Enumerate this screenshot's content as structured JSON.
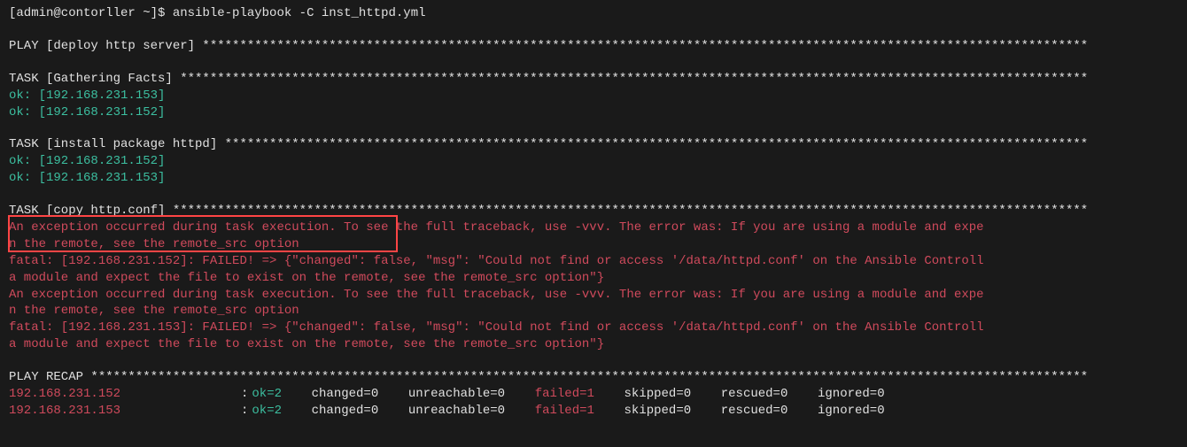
{
  "prompt": "[admin@contorller ~]$ ",
  "command": "ansible-playbook -C inst_httpd.yml",
  "play_header": "PLAY [deploy http server] ***********************************************************************************************************************",
  "task_gathering": "TASK [Gathering Facts] **************************************************************************************************************************",
  "ok_153": "ok: [192.168.231.153]",
  "ok_152": "ok: [192.168.231.152]",
  "task_install": "TASK [install package httpd] ********************************************************************************************************************",
  "task_copy": "TASK [copy http.conf] ***************************************************************************************************************************",
  "exception_line1": "An exception occurred during task execution. To see the full traceback, use -vvv. The error was: If you are using a module and expe",
  "exception_line2": "n the remote, see the remote_src option",
  "fatal_152_line1": "fatal: [192.168.231.152]: FAILED! => {\"changed\": false, \"msg\": \"Could not find or access '/data/httpd.conf' on the Ansible Controll",
  "fatal_152_line2": "a module and expect the file to exist on the remote, see the remote_src option\"}",
  "fatal_153_line1": "fatal: [192.168.231.153]: FAILED! => {\"changed\": false, \"msg\": \"Could not find or access '/data/httpd.conf' on the Ansible Controll",
  "fatal_153_line2": "a module and expect the file to exist on the remote, see the remote_src option\"}",
  "play_recap": "PLAY RECAP **************************************************************************************************************************************",
  "recap": [
    {
      "host": "192.168.231.152",
      "ok": "ok=2",
      "changed": "changed=0",
      "unreachable": "unreachable=0",
      "failed": "failed=1",
      "skipped": "skipped=0",
      "rescued": "rescued=0",
      "ignored": "ignored=0"
    },
    {
      "host": "192.168.231.153",
      "ok": "ok=2",
      "changed": "changed=0",
      "unreachable": "unreachable=0",
      "failed": "failed=1",
      "skipped": "skipped=0",
      "rescued": "rescued=0",
      "ignored": "ignored=0"
    }
  ]
}
